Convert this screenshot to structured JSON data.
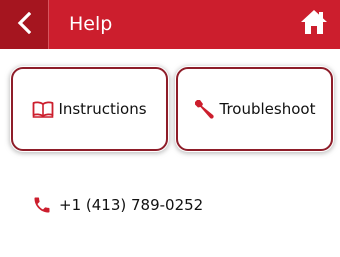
{
  "header": {
    "title": "Help",
    "back_icon": "chevron-left-icon",
    "home_icon": "home-icon",
    "color": "#cc1e2d"
  },
  "buttons": {
    "instructions": {
      "label": "Instructions",
      "icon": "book-icon"
    },
    "troubleshoot": {
      "label": "Troubleshoot",
      "icon": "wrench-icon"
    }
  },
  "contact": {
    "phone": "+1 (413) 789-0252",
    "icon": "phone-icon"
  },
  "colors": {
    "accent": "#cc1e2d",
    "card_border": "#8e1d29"
  }
}
